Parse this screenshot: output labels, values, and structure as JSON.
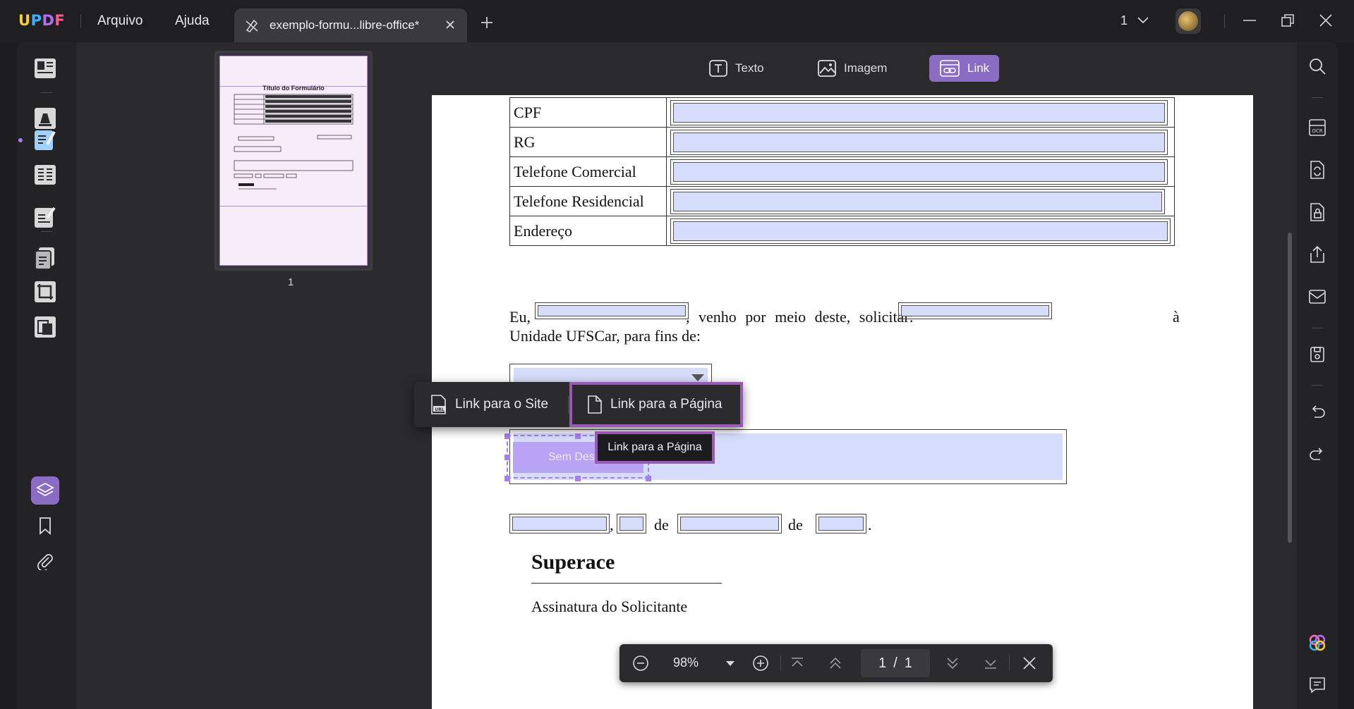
{
  "app": {
    "logo": "UPDF",
    "logo_colors": [
      "#ffcc33",
      "#3ab0ff",
      "#b46cf0",
      "#ff5b8a"
    ],
    "menu": [
      "Arquivo",
      "Ajuda"
    ]
  },
  "tab": {
    "title": "exemplo-formu...libre-office*"
  },
  "titlebar": {
    "page_selector": "1"
  },
  "edit_toolbar": {
    "items": [
      {
        "label": "Texto",
        "icon": "text-icon",
        "active": false
      },
      {
        "label": "Imagem",
        "icon": "image-icon",
        "active": false
      },
      {
        "label": "Link",
        "icon": "link-icon",
        "active": true
      }
    ]
  },
  "thumbnail": {
    "page_number": "1",
    "title": "Título do Formulário"
  },
  "document": {
    "table_rows": [
      "CPF",
      "RG",
      "Telefone Comercial",
      "Telefone Residencial",
      "Endereço"
    ],
    "para_eu": "Eu,",
    "para_venho": ", venho por meio deste, solicitar:",
    "para_a": "à",
    "para_line2": "Unidade UFSCar, para fins de:",
    "button_text": "Sem Dest",
    "comma": ",",
    "de1": "de",
    "de2": "de",
    "period": ".",
    "signature": "Superace",
    "signature_label": "Assinatura do Solicitante"
  },
  "link_popup": {
    "site_label": "Link para o Site",
    "page_label": "Link para a Página"
  },
  "tooltip": {
    "text": "Link para a Página"
  },
  "zoom_bar": {
    "zoom": "98%",
    "current_page": "1",
    "separator": "/",
    "total_pages": "1"
  },
  "colors": {
    "accent": "#8a6cc4",
    "highlight_border": "#9b59b6",
    "field_fill": "#d6ddfb"
  }
}
